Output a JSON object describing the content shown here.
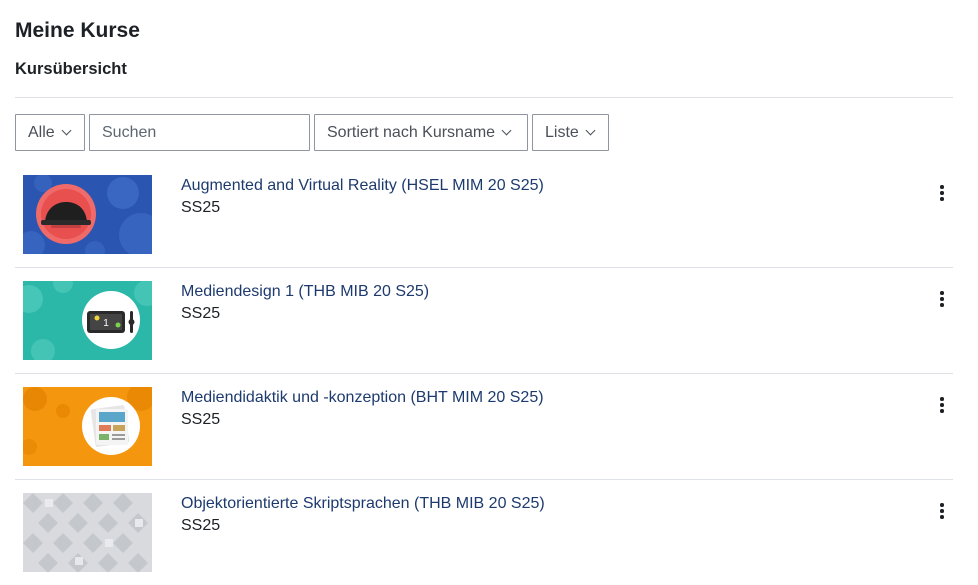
{
  "page": {
    "title": "Meine Kurse",
    "section_title": "Kursübersicht"
  },
  "filters": {
    "grouping": "Alle",
    "search_placeholder": "Suchen",
    "sort": "Sortiert nach Kursname",
    "view": "Liste"
  },
  "courses": [
    {
      "name": "Augmented and Virtual Reality (HSEL MIM 20 S25)",
      "term": "SS25",
      "thumb_color": "#2a55b0",
      "icon": "vr-headset-icon"
    },
    {
      "name": "Mediendesign 1 (THB MIB 20 S25)",
      "term": "SS25",
      "thumb_color": "#2bb8a8",
      "icon": "device-icon"
    },
    {
      "name": "Mediendidaktik und -konzeption (BHT MIM 20 S25)",
      "term": "SS25",
      "thumb_color": "#f5960f",
      "icon": "document-icon"
    },
    {
      "name": "Objektorientierte Skriptsprachen (THB MIB 20 S25)",
      "term": "SS25",
      "thumb_color": "#d8dade",
      "icon": "pattern-icon"
    }
  ],
  "colors": {
    "link": "#1d3a6e",
    "border": "#dee2e6",
    "text": "#1d2125"
  }
}
